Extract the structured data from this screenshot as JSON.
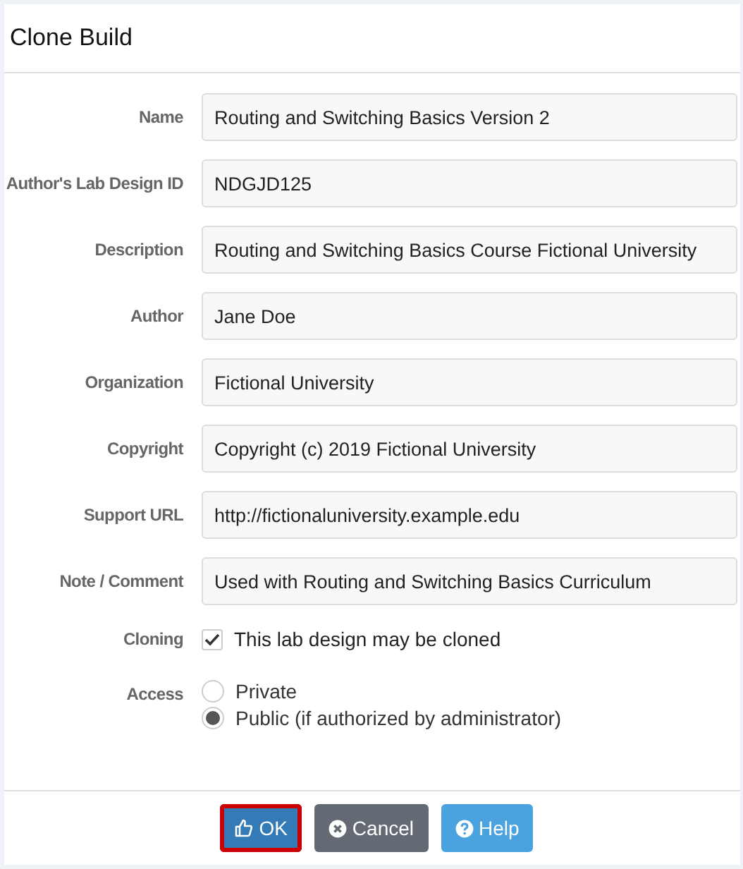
{
  "dialog": {
    "title": "Clone Build"
  },
  "fields": [
    {
      "label": "Name",
      "value": "Routing and Switching Basics Version 2"
    },
    {
      "label": "Author's Lab Design ID",
      "value": "NDGJD125"
    },
    {
      "label": "Description",
      "value": "Routing and Switching Basics Course Fictional University"
    },
    {
      "label": "Author",
      "value": "Jane Doe"
    },
    {
      "label": "Organization",
      "value": "Fictional University"
    },
    {
      "label": "Copyright",
      "value": "Copyright (c) 2019 Fictional University"
    },
    {
      "label": "Support URL",
      "value": "http://fictionaluniversity.example.edu"
    },
    {
      "label": "Note / Comment",
      "value": "Used with Routing and Switching Basics Curriculum"
    }
  ],
  "cloning": {
    "label": "Cloning",
    "option": "This lab design may be cloned",
    "checked": true
  },
  "access": {
    "label": "Access",
    "options": [
      {
        "label": "Private",
        "selected": false
      },
      {
        "label": "Public (if authorized by administrator)",
        "selected": true
      }
    ]
  },
  "buttons": [
    {
      "kind": "ok",
      "label": "OK",
      "focused": true
    },
    {
      "kind": "cancel",
      "label": "Cancel",
      "focused": false
    },
    {
      "kind": "help",
      "label": "Help",
      "focused": false
    }
  ]
}
